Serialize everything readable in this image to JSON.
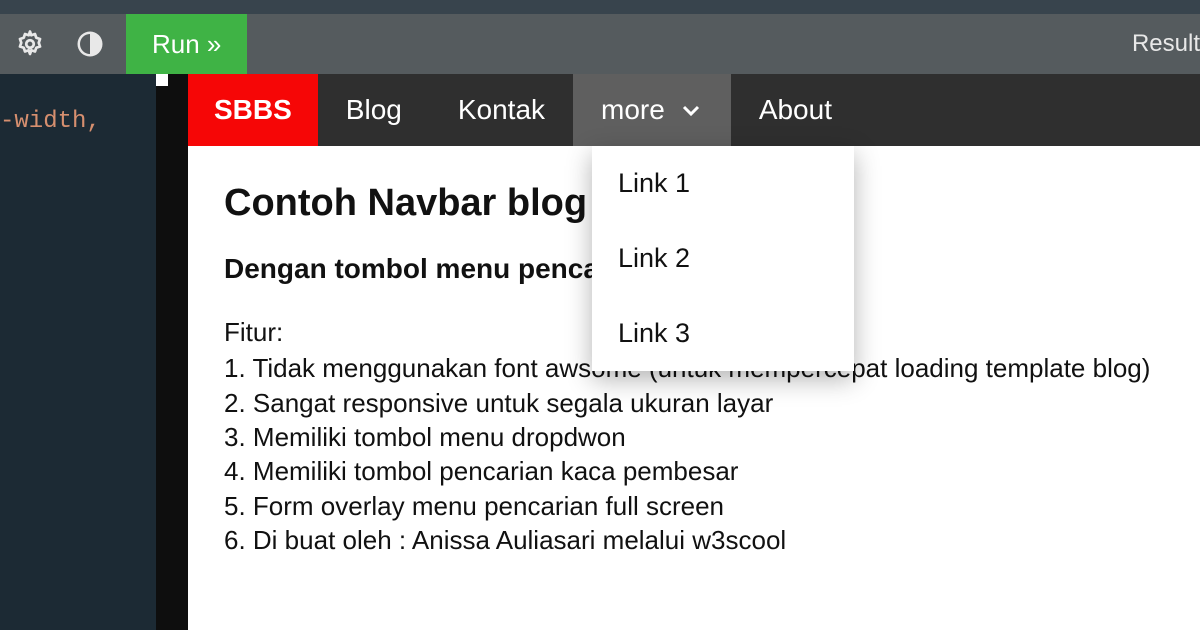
{
  "toolbar": {
    "run_label": "Run »",
    "result_label": "Result"
  },
  "code_pane": {
    "fragment": "-width,"
  },
  "navbar": {
    "brand": "SBBS",
    "items": [
      "Blog",
      "Kontak"
    ],
    "more_label": "more",
    "about_label": "About"
  },
  "dropdown": {
    "items": [
      "Link 1",
      "Link 2",
      "Link 3"
    ]
  },
  "page": {
    "heading1": "Contoh Navbar blog responsive",
    "heading2": "Dengan tombol menu pencarian",
    "features_label": "Fitur:",
    "features": [
      "1. Tidak menggunakan font awsome (untuk mempercepat loading template blog)",
      "2. Sangat responsive untuk segala ukuran layar",
      "3. Memiliki tombol menu dropdwon",
      "4. Memiliki tombol pencarian kaca pembesar",
      "5. Form overlay menu pencarian full screen",
      "6. Di buat oleh : Anissa Auliasari melalui w3scool"
    ]
  }
}
